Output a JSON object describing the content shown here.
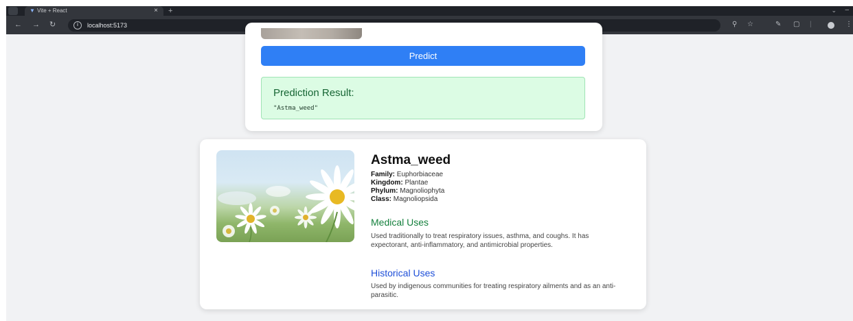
{
  "browser": {
    "tab_title": "Vite + React",
    "url": "localhost:5173"
  },
  "predict": {
    "button_label": "Predict",
    "result_title": "Prediction Result:",
    "result_value": "\"Astma_weed\""
  },
  "plant": {
    "name": "Astma_weed",
    "taxonomy": [
      {
        "label": "Family:",
        "value": "Euphorbiaceae"
      },
      {
        "label": "Kingdom:",
        "value": "Plantae"
      },
      {
        "label": "Phylum:",
        "value": "Magnoliophyta"
      },
      {
        "label": "Class:",
        "value": "Magnoliopsida"
      }
    ],
    "medical_title": "Medical Uses",
    "medical_text": "Used traditionally to treat respiratory issues, asthma, and coughs. It has expectorant, anti-inflammatory, and antimicrobial properties.",
    "historical_title": "Historical Uses",
    "historical_text": "Used by indigenous communities for treating respiratory ailments and as an anti-parasitic."
  },
  "colors": {
    "accent_blue": "#2f7ff5",
    "success_bg": "#dcfce4",
    "medical_green": "#15803d",
    "historical_blue": "#1d4ed8"
  }
}
